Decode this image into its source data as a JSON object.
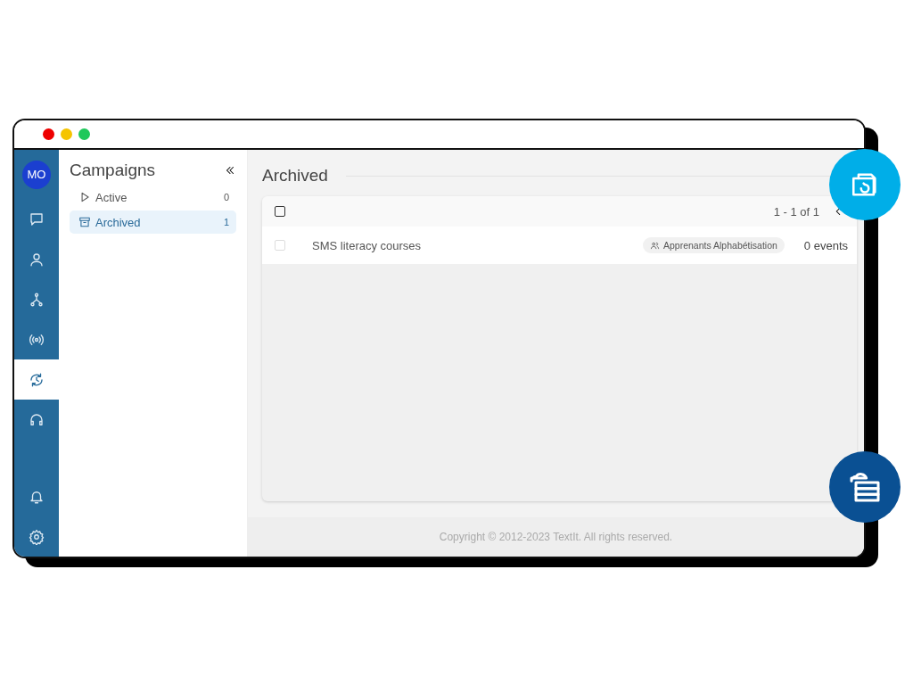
{
  "nav": {
    "avatar": "MO",
    "items": [
      {
        "kind": "chat",
        "selected": false
      },
      {
        "kind": "contacts",
        "selected": false
      },
      {
        "kind": "flows",
        "selected": false
      },
      {
        "kind": "channels",
        "selected": false
      },
      {
        "kind": "campaigns",
        "selected": true
      },
      {
        "kind": "support",
        "selected": false
      }
    ],
    "bottom_items": [
      {
        "kind": "notifications",
        "selected": false
      },
      {
        "kind": "settings",
        "selected": false
      }
    ]
  },
  "sidebar": {
    "title": "Campaigns",
    "items": [
      {
        "kind": "active",
        "label": "Active",
        "count": "0",
        "selected": false
      },
      {
        "kind": "archived",
        "label": "Archived",
        "count": "1",
        "selected": true
      }
    ]
  },
  "main": {
    "title": "Archived",
    "select_all_checked": false,
    "pagination": "1 - 1 of 1",
    "rows": [
      {
        "name": "SMS literacy courses",
        "group": "Apprenants Alphabétisation",
        "events": "0 events",
        "checked": false
      }
    ]
  },
  "footer": "Copyright © 2012-2023 TextIt. All rights reserved."
}
